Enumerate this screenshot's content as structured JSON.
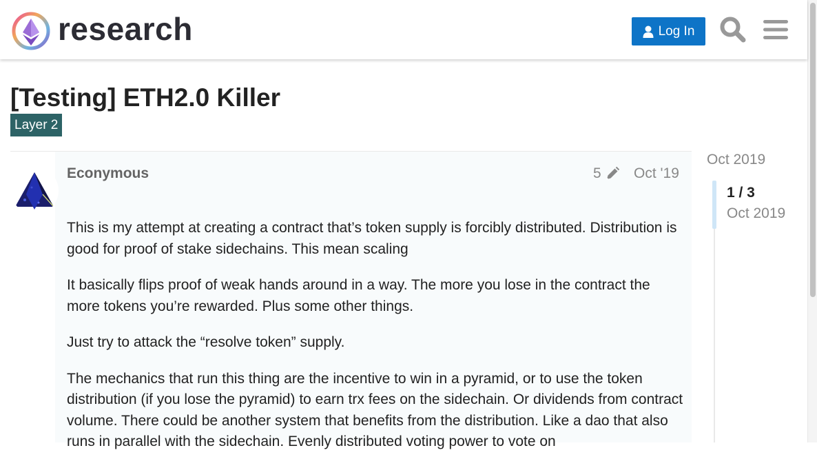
{
  "header": {
    "logo_text": "research",
    "login_label": "Log In"
  },
  "topic": {
    "title": "[Testing] ETH2.0 Killer",
    "category": "Layer 2"
  },
  "post": {
    "username": "Econymous",
    "edit_count": "5",
    "date": "Oct '19",
    "paragraphs": [
      "This is my attempt at creating a contract that’s token supply is forcibly distributed. Distribution is good for proof of stake sidechains. This mean scaling",
      "It basically flips proof of weak hands around in a way. The more you lose in the contract the more tokens you’re rewarded. Plus some other things.",
      "Just try to attack the “resolve token” supply.",
      "The mechanics that run this thing are the incentive to win in a pyramid, or to use the token distribution (if you lose the pyramid) to earn trx fees on the sidechain. Or dividends from contract volume. There could be another system that benefits from the distribution. Like a dao that also runs in parallel with the sidechain. Evenly distributed voting power to vote on"
    ]
  },
  "timeline": {
    "top_date": "Oct 2019",
    "position": "1 / 3",
    "current_date": "Oct 2019"
  },
  "icons": {
    "logo": "ethereum-research-logo",
    "login": "user-icon",
    "search": "search-icon",
    "menu": "hamburger-menu-icon",
    "edit": "pencil-icon"
  },
  "colors": {
    "login_button": "#0e74c7",
    "category_badge": "#2d6366",
    "muted_text": "#888888",
    "timeline_handle": "#cfe6f7"
  }
}
